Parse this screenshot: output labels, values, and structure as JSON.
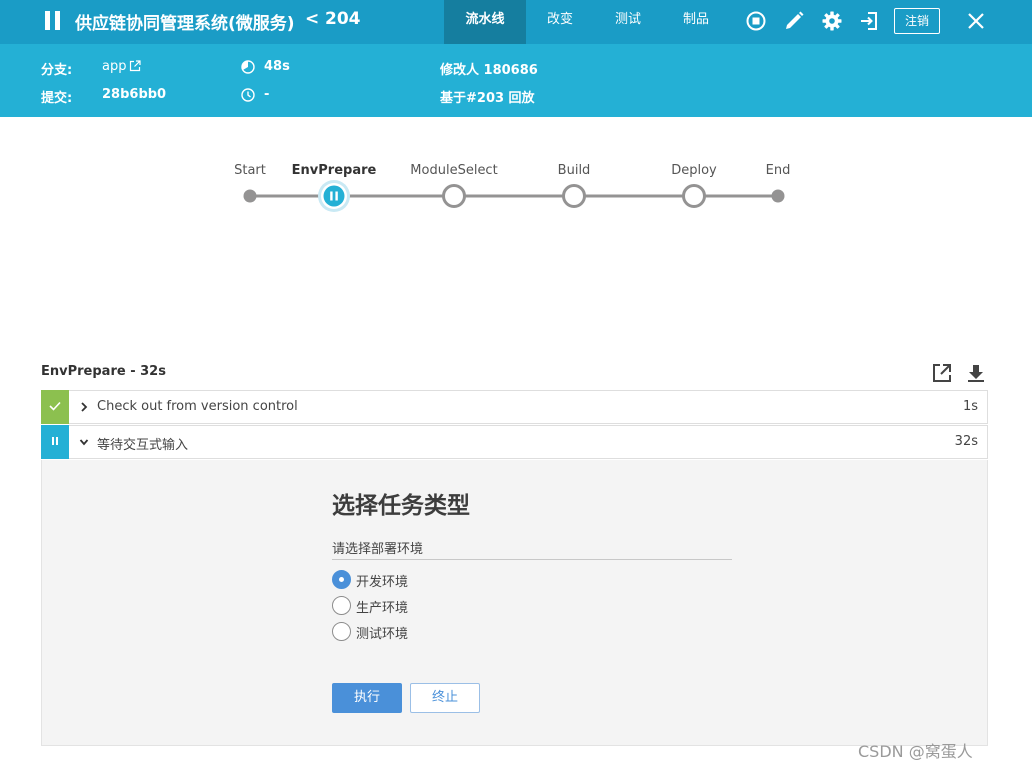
{
  "header": {
    "app_title": "供应链协同管理系统(微服务)",
    "back_chevron": "<",
    "run_number": "204",
    "tabs": [
      {
        "label": "流水线",
        "active": true
      },
      {
        "label": "改变",
        "active": false
      },
      {
        "label": "测试",
        "active": false
      },
      {
        "label": "制品",
        "active": false
      }
    ],
    "icons": [
      "pause-icon",
      "stop-icon",
      "edit-icon",
      "gear-icon",
      "exit-icon",
      "close-icon"
    ],
    "logout_label": "注销",
    "colors": {
      "bar": "#1a9cc6",
      "active_tab": "#157e9f"
    }
  },
  "info": {
    "branch_label": "分支:",
    "branch_value": "app",
    "commit_label": "提交:",
    "commit_value": "28b6bb0",
    "duration_value": "48s",
    "time_value": "-",
    "changer_value": "修改人 180686",
    "based_on_value": "基于#203 回放",
    "colors": {
      "bar": "#24b0d5"
    }
  },
  "pipeline": {
    "stages": [
      {
        "label": "Start",
        "kind": "endpoint"
      },
      {
        "label": "EnvPrepare",
        "kind": "paused",
        "current": true
      },
      {
        "label": "ModuleSelect",
        "kind": "not_built"
      },
      {
        "label": "Build",
        "kind": "not_built"
      },
      {
        "label": "Deploy",
        "kind": "not_built"
      },
      {
        "label": "End",
        "kind": "endpoint"
      }
    ],
    "colors": {
      "line": "#949393",
      "paused": "#24b0d5",
      "paused_ring": "#c9e9f4"
    }
  },
  "log": {
    "stage_heading": "EnvPrepare - 32s",
    "icons": [
      "popout-icon",
      "download-icon"
    ],
    "steps": [
      {
        "title": "Check out from version control",
        "duration": "1s",
        "status": "success",
        "expanded": false
      },
      {
        "title": "等待交互式输入",
        "duration": "32s",
        "status": "paused",
        "expanded": true
      }
    ],
    "colors": {
      "success": "#8cc04f",
      "paused": "#24b0d5"
    }
  },
  "input": {
    "title": "选择任务类型",
    "prompt": "请选择部署环境",
    "options": [
      {
        "label": "开发环境",
        "checked": true
      },
      {
        "label": "生产环境",
        "checked": false
      },
      {
        "label": "测试环境",
        "checked": false
      }
    ],
    "proceed_label": "执行",
    "abort_label": "终止",
    "colors": {
      "primary": "#4a90d9"
    }
  },
  "watermark": "CSDN @窝蛋人"
}
